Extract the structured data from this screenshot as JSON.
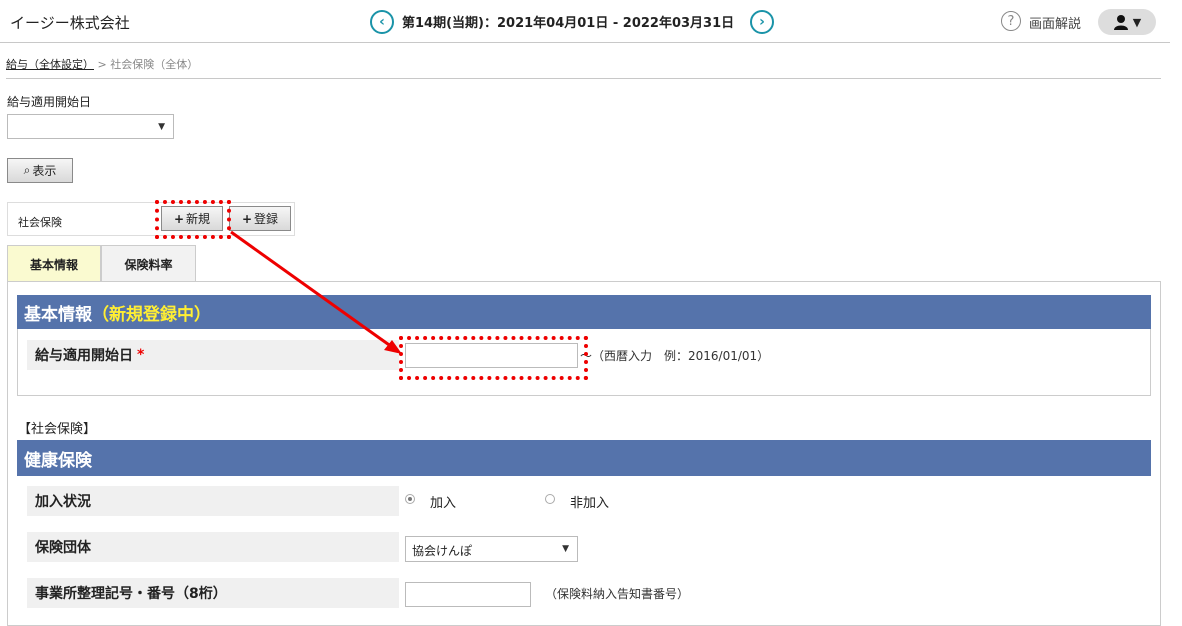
{
  "header": {
    "company": "イージー株式会社",
    "prev_icon": "chevron-left-icon",
    "next_icon": "chevron-right-icon",
    "period": "第14期(当期)：2021年04月01日 - 2022年03月31日",
    "help_label": "画面解説",
    "user_icon": "user-icon"
  },
  "breadcrumb": {
    "link": "給与（全体設定）",
    "separator": ">",
    "current": "社会保険（全体）"
  },
  "filter": {
    "label": "給与適用開始日",
    "selected": "",
    "show_button": "表示"
  },
  "toolbar": {
    "label": "社会保険",
    "new_button": "新規",
    "register_button": "登録"
  },
  "tabs": [
    {
      "label": "基本情報",
      "active": true
    },
    {
      "label": "保険料率",
      "active": false
    }
  ],
  "basic": {
    "title": "基本情報",
    "status": "（新規登録中）",
    "start_label": "給与適用開始日",
    "required_mark": "*",
    "start_value": "",
    "start_suffix": "～（西暦入力　例：2016/01/01）"
  },
  "social_section_label": "【社会保険】",
  "health": {
    "title": "健康保険",
    "join_label": "加入状況",
    "join_options": [
      "加入",
      "非加入"
    ],
    "join_selected": "加入",
    "insurer_label": "保険団体",
    "insurer_value": "協会けんぽ",
    "office_label": "事業所整理記号・番号（8桁）",
    "office_value": "",
    "office_hint": "（保険料納入告知書番号）"
  },
  "colors": {
    "section_header": "#5573ab",
    "status_text": "#ffee33",
    "nav_accent": "#1a93a8",
    "highlight": "#ee0000",
    "active_tab": "#fafad0"
  }
}
